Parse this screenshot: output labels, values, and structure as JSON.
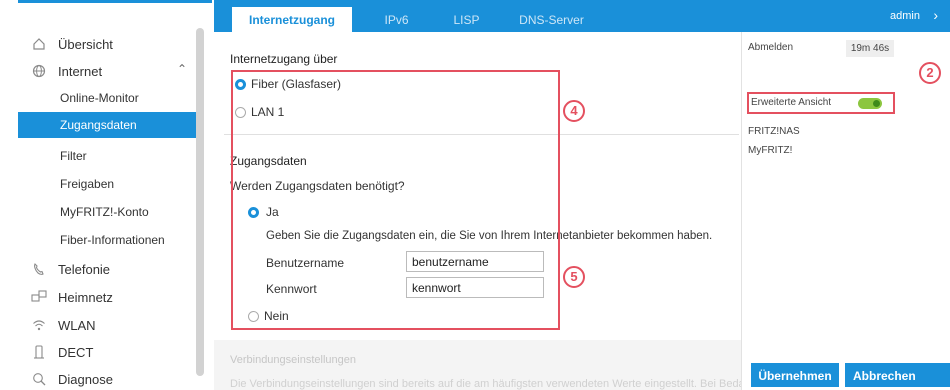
{
  "sidebar": {
    "items": [
      {
        "label": "Übersicht",
        "icon": "home-icon"
      },
      {
        "label": "Internet",
        "icon": "globe-icon"
      },
      {
        "label": "Telefonie",
        "icon": "phone-icon"
      },
      {
        "label": "Heimnetz",
        "icon": "network-icon"
      },
      {
        "label": "WLAN",
        "icon": "wifi-icon"
      },
      {
        "label": "DECT",
        "icon": "dect-handset-icon"
      },
      {
        "label": "Diagnose",
        "icon": "diagnose-icon"
      }
    ],
    "internet_sub": [
      "Online-Monitor",
      "Zugangsdaten",
      "Filter",
      "Freigaben",
      "MyFRITZ!-Konto",
      "Fiber-Informationen"
    ],
    "active_sub": "Zugangsdaten"
  },
  "tabs": [
    "Internetzugang",
    "IPv6",
    "LISP",
    "DNS-Server"
  ],
  "active_tab": "Internetzugang",
  "user": {
    "label": "admin"
  },
  "right_panel": {
    "logout": "Abmelden",
    "session_time": "19m 46s",
    "advanced_view": "Erweiterte Ansicht",
    "nas": "FRITZ!NAS",
    "myfritz": "MyFRITZ!"
  },
  "main": {
    "section_access_title": "Internetzugang über",
    "access_options": [
      "Fiber (Glasfaser)",
      "LAN 1"
    ],
    "section_credentials_title": "Zugangsdaten",
    "question": "Werden Zugangsdaten benötigt?",
    "yes": "Ja",
    "hint": "Geben Sie die Zugangsdaten ein, die Sie von Ihrem Internetanbieter bekommen haben.",
    "username_label": "Benutzername",
    "username_value": "benutzername",
    "password_label": "Kennwort",
    "password_value": "kennwort",
    "no": "Nein",
    "connection_title": "Verbindungseinstellungen",
    "connection_text": "Die Verbindungseinstellungen sind bereits auf die am häufigsten verwendeten Werte eingestellt. Bei Bedarf können Sie diese Werte"
  },
  "buttons": {
    "apply": "Übernehmen",
    "cancel": "Abbrechen"
  },
  "annotations": [
    "2",
    "4",
    "5"
  ],
  "colors": {
    "accent": "#1a90d9",
    "highlight": "#e4505f",
    "toggle_on": "#8cc63f"
  }
}
